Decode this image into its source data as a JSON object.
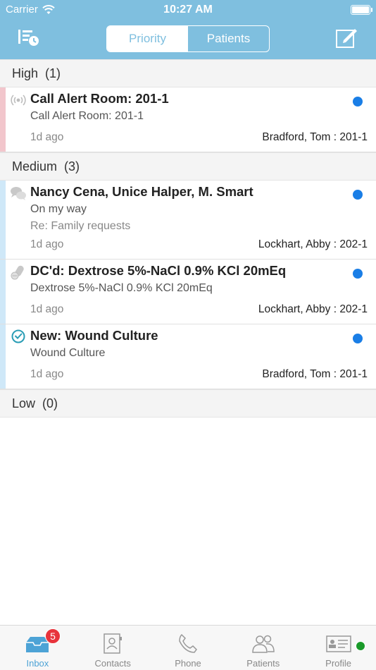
{
  "status": {
    "carrier": "Carrier",
    "time": "10:27 AM"
  },
  "nav": {
    "segments": [
      {
        "label": "Priority",
        "active": true
      },
      {
        "label": "Patients",
        "active": false
      }
    ],
    "left_icon": "priority-sort-icon",
    "right_icon": "compose-icon"
  },
  "sections": {
    "high": {
      "label": "High",
      "count": "(1)"
    },
    "medium": {
      "label": "Medium",
      "count": "(3)"
    },
    "low": {
      "label": "Low",
      "count": "(0)"
    }
  },
  "items": [
    {
      "icon": "call-alert-icon",
      "title": "Call Alert Room: 201-1",
      "line1": "Call Alert Room: 201-1",
      "line2": "",
      "ago": "1d ago",
      "patient": "Bradford, Tom : 201-1",
      "unread": true
    },
    {
      "icon": "chat-bubbles-icon",
      "title": "Nancy Cena, Unice Halper, M. Smart",
      "line1": "On my way",
      "line2": "Re: Family requests",
      "ago": "1d ago",
      "patient": "Lockhart, Abby : 202-1",
      "unread": true
    },
    {
      "icon": "medication-pills-icon",
      "title": "DC'd: Dextrose 5%-NaCl 0.9% KCl 20mEq",
      "line1": "Dextrose 5%-NaCl 0.9% KCl 20mEq",
      "line2": "",
      "ago": "1d ago",
      "patient": "Lockhart, Abby : 202-1",
      "unread": true
    },
    {
      "icon": "lab-result-clock-icon",
      "title": "New: Wound Culture",
      "line1": "Wound Culture",
      "line2": "",
      "ago": "1d ago",
      "patient": "Bradford, Tom : 201-1",
      "unread": true
    }
  ],
  "tabs": [
    {
      "label": "Inbox",
      "icon": "inbox-icon",
      "active": true,
      "badge": "5"
    },
    {
      "label": "Contacts",
      "icon": "contacts-icon",
      "active": false
    },
    {
      "label": "Phone",
      "icon": "phone-icon",
      "active": false
    },
    {
      "label": "Patients",
      "icon": "patients-icon",
      "active": false
    },
    {
      "label": "Profile",
      "icon": "profile-card-icon",
      "active": false
    }
  ],
  "colors": {
    "accent": "#7fbfdf",
    "unread": "#1a7ee6",
    "high": "#f2c6cc",
    "medium": "#cfe8f8",
    "badge": "#e8343c",
    "presence": "#1a9a2a"
  }
}
